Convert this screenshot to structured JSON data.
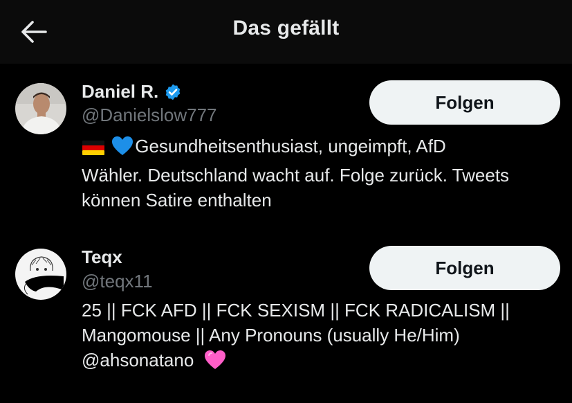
{
  "header": {
    "title": "Das gefällt",
    "back_icon": "arrow-left-icon"
  },
  "users": [
    {
      "display_name": "Daniel R.",
      "handle": "@Danielslow777",
      "verified": true,
      "verified_color": "#1d9bf0",
      "follow_label": "Folgen",
      "bio_emojis": [
        "german-flag-icon",
        "blue-heart-icon"
      ],
      "bio_line1": "Gesundheitsenthusiast, ungeimpft, AfD",
      "bio_line2": "Wähler. Deutschland wacht auf. Folge zurück. Tweets",
      "bio_line3": "können Satire enthalten"
    },
    {
      "display_name": "Teqx",
      "handle": "@teqx11",
      "verified": false,
      "follow_label": "Folgen",
      "bio_line1": "25 || FCK AFD || FCK SEXISM || FCK RADICALISM ||",
      "bio_line2": "Mangomouse || Any Pronouns (usually He/Him)",
      "bio_mention": "@ahsonatano",
      "bio_emojis": [
        "pink-heart-icon"
      ]
    }
  ],
  "colors": {
    "background": "#000000",
    "header_bg": "#0b0b0b",
    "text_primary": "#e7e9ea",
    "text_secondary": "#71767b",
    "button_bg": "#eff3f4",
    "button_text": "#0f1419",
    "pink_heart": "#ff5ec8",
    "blue_heart": "#1d8fe8"
  }
}
